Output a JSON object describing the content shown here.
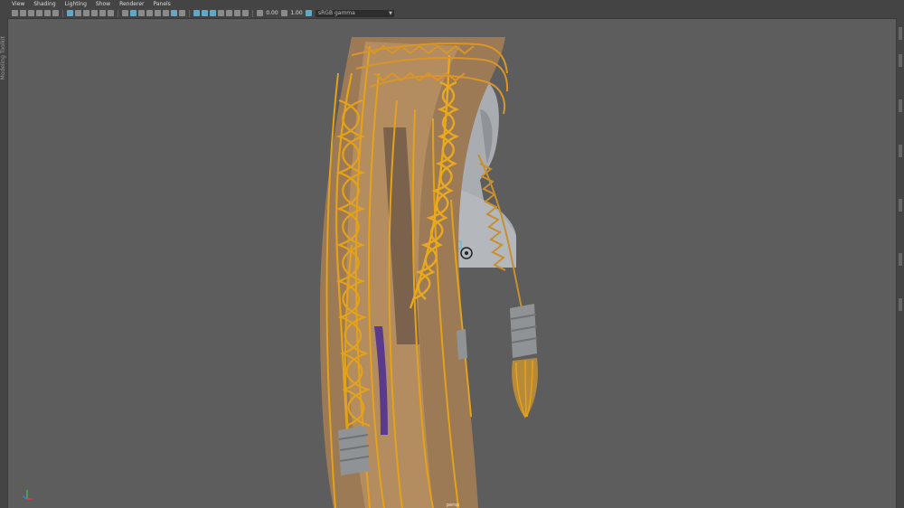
{
  "menu": [
    "View",
    "Shading",
    "Lighting",
    "Show",
    "Renderer",
    "Panels"
  ],
  "toolbar": {
    "exposure": "0.00",
    "gamma": "1.00",
    "color_space": "sRGB gamma",
    "dropdown_icon": "chevron-down-icon"
  },
  "viewport": {
    "camera_label": "persp",
    "background_color": "#5d5d5d",
    "hair_color": "#e3a21a",
    "mesh_color": "#a8acb0"
  },
  "left_strip_label": "Modeling Toolkit"
}
